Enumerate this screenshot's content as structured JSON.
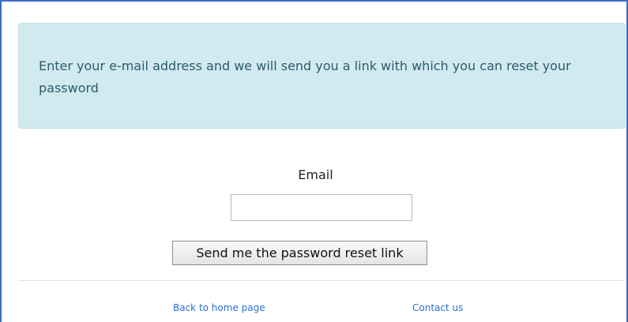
{
  "info": {
    "message": "Enter your e-mail address and we will send you a link with which you can reset your password"
  },
  "form": {
    "email_label": "Email",
    "email_value": "",
    "submit_label": "Send me the password reset link"
  },
  "footer": {
    "home_link": "Back to home page",
    "contact_link": "Contact us"
  },
  "colors": {
    "frame_border": "#3d6bc4",
    "info_background": "#d1eaf0",
    "info_text": "#2b5c6b",
    "link": "#2a6fd6"
  }
}
